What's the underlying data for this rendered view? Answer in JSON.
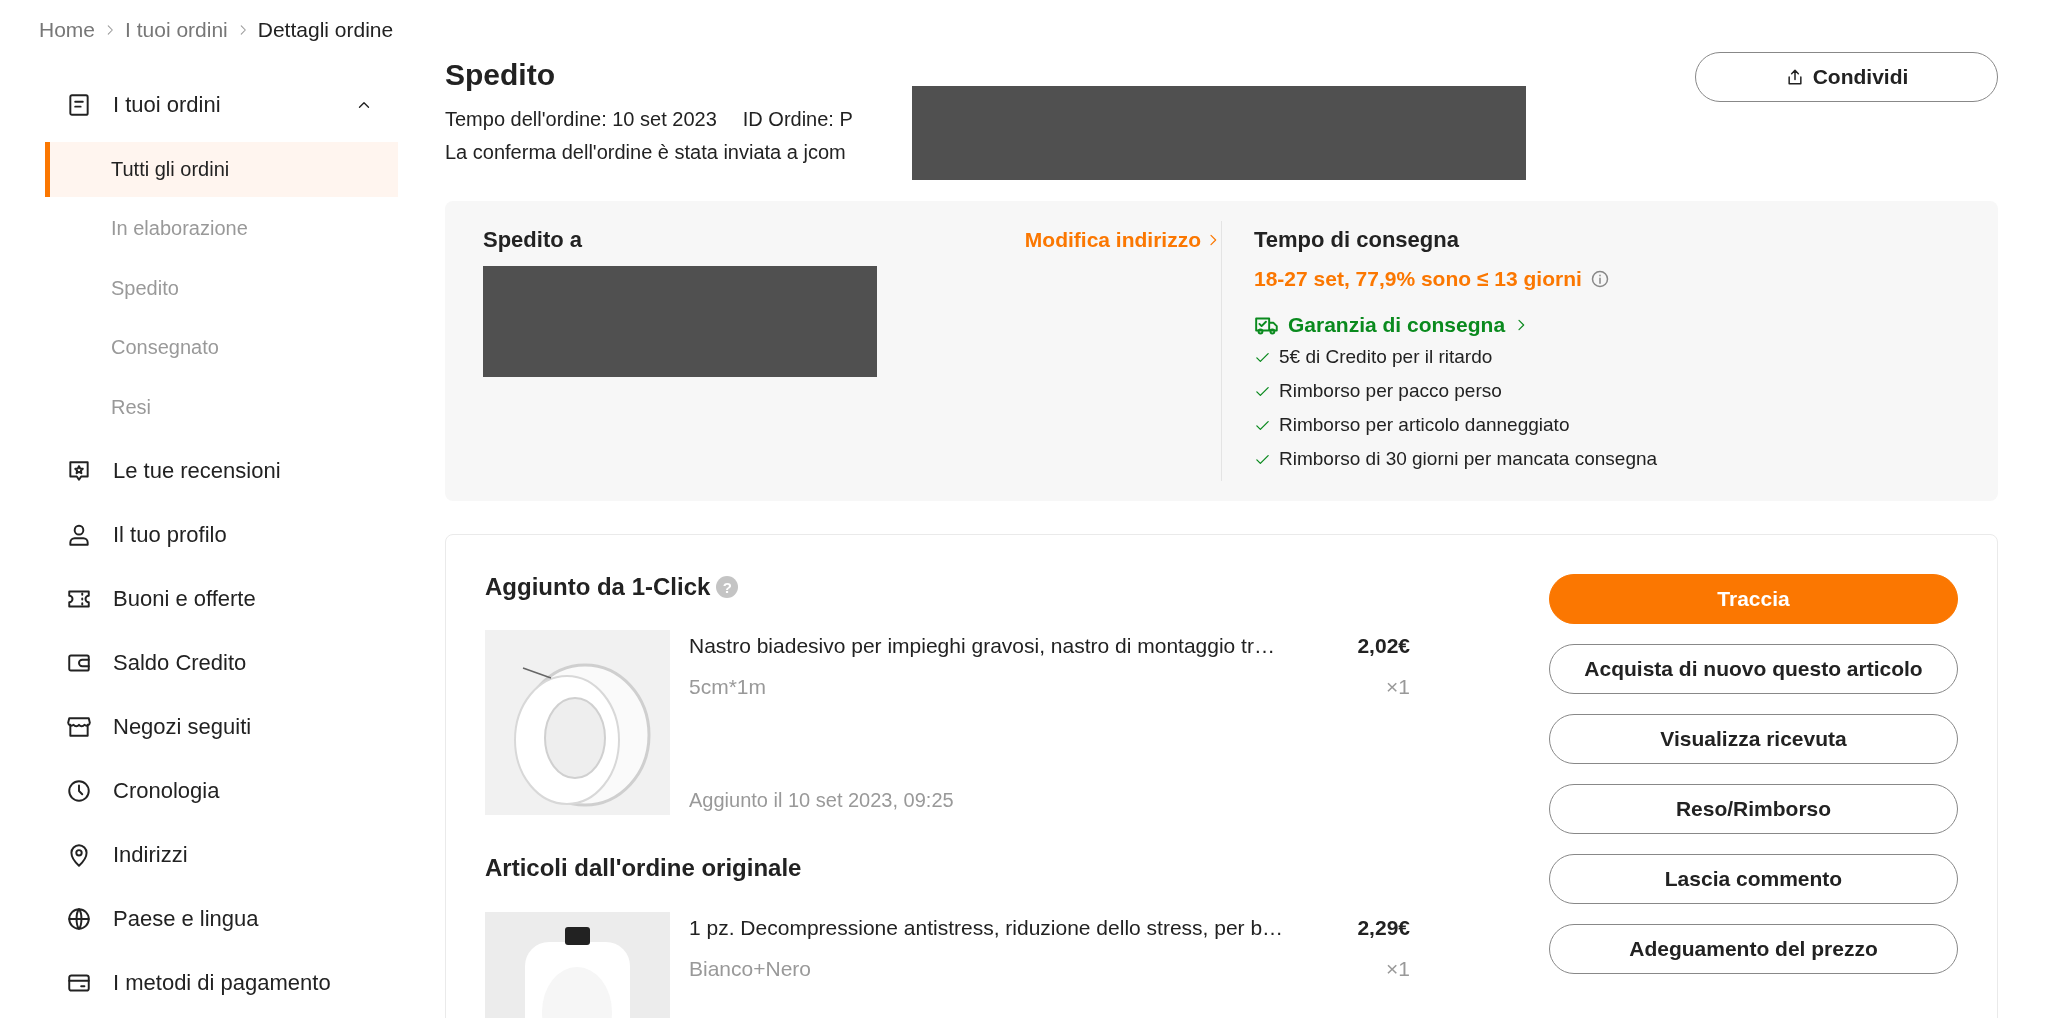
{
  "breadcrumb": [
    {
      "label": "Home",
      "current": false
    },
    {
      "label": "I tuoi ordini",
      "current": false
    },
    {
      "label": "Dettagli ordine",
      "current": true
    }
  ],
  "sidebar": {
    "section": {
      "label": "I tuoi ordini",
      "expanded": true,
      "children": [
        {
          "label": "Tutti gli ordini",
          "selected": true
        },
        {
          "label": "In elaborazione",
          "selected": false
        },
        {
          "label": "Spedito",
          "selected": false
        },
        {
          "label": "Consegnato",
          "selected": false
        },
        {
          "label": "Resi",
          "selected": false
        }
      ]
    },
    "items": [
      {
        "label": "Le tue recensioni"
      },
      {
        "label": "Il tuo profilo"
      },
      {
        "label": "Buoni e offerte"
      },
      {
        "label": "Saldo Credito"
      },
      {
        "label": "Negozi seguiti"
      },
      {
        "label": "Cronologia"
      },
      {
        "label": "Indirizzi"
      },
      {
        "label": "Paese e lingua"
      },
      {
        "label": "I metodi di pagamento"
      }
    ]
  },
  "order": {
    "status": "Spedito",
    "share_button": "Condividi",
    "order_time": "Tempo dell'ordine: 10 set 2023",
    "order_id": "ID Ordine: P",
    "confirmation": "La conferma dell'ordine è stata inviata a jcom"
  },
  "shipping": {
    "title": "Spedito a",
    "edit_link": "Modifica indirizzo"
  },
  "delivery": {
    "title": "Tempo di consegna",
    "estimate": "18-27 set, 77,9% sono ≤ 13 giorni",
    "guarantee": "Garanzia di consegna",
    "benefits": [
      "5€ di Credito per il ritardo",
      "Rimborso per pacco perso",
      "Rimborso per articolo danneggiato",
      "Rimborso di 30 giorni per mancata consegna"
    ]
  },
  "sections": [
    {
      "title": "Aggiunto da 1-Click",
      "help": "?",
      "products": [
        {
          "name": "Nastro biadesivo per impieghi gravosi, nastro di montaggio tr…",
          "price": "2,02€",
          "variant": "5cm*1m",
          "quantity": "×1",
          "added": "Aggiunto il 10 set 2023, 09:25"
        }
      ]
    },
    {
      "title": "Articoli dall'ordine originale",
      "products": [
        {
          "name": "1 pz. Decompressione antistress, riduzione dello stress, per b…",
          "price": "2,29€",
          "variant": "Bianco+Nero",
          "quantity": "×1"
        }
      ]
    }
  ],
  "actions": [
    {
      "label": "Traccia",
      "kind": "primary"
    },
    {
      "label": "Acquista di nuovo questo articolo",
      "kind": "secondary"
    },
    {
      "label": "Visualizza ricevuta",
      "kind": "secondary"
    },
    {
      "label": "Reso/Rimborso",
      "kind": "secondary"
    },
    {
      "label": "Lascia commento",
      "kind": "secondary"
    },
    {
      "label": "Adeguamento del prezzo",
      "kind": "secondary"
    }
  ]
}
